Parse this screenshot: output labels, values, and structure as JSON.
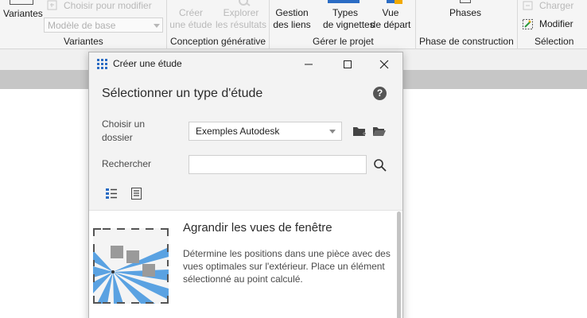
{
  "ribbon": {
    "variants_btn": "Variantes",
    "choose_to_modify": "Choisir pour modifier",
    "model_combo": "Modèle de base",
    "create_study_l1": "Créer",
    "create_study_l2": "une étude",
    "explore_l1": "Explorer",
    "explore_l2": "les résultats",
    "manage_links_l1": "Gestion",
    "manage_links_l2": "des liens",
    "thumb_types_l1": "Types",
    "thumb_types_l2": "de vignettes",
    "start_view_l1": "Vue",
    "start_view_l2": "de départ",
    "phases_btn": "Phases",
    "load_btn": "Charger",
    "modify_btn": "Modifier",
    "group_variants": "Variantes",
    "group_generative": "Conception générative",
    "group_manage": "Gérer le projet",
    "group_phase": "Phase de construction",
    "group_selection": "Sélection"
  },
  "dialog": {
    "title": "Créer une étude",
    "heading": "Sélectionner un type d'étude",
    "help": "?",
    "folder_label": "Choisir un dossier",
    "folder_value": "Exemples Autodesk",
    "search_label": "Rechercher",
    "search_value": "",
    "item": {
      "title": "Agrandir les vues de fenêtre",
      "description": "Détermine les positions dans une pièce avec des vues optimales sur l'extérieur. Place un élément sélectionné au point calculé."
    }
  },
  "colors": {
    "thumb_blue": "#4a90d9",
    "thumb_gray": "#9a9a9a",
    "accent": "#2b6cc4"
  }
}
